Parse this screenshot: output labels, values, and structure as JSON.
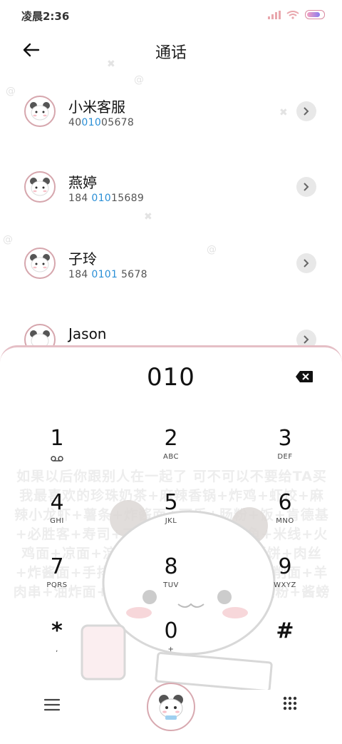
{
  "status_bar": {
    "time": "凌晨2:36"
  },
  "header": {
    "title": "通话"
  },
  "contacts": [
    {
      "name": "小米客服",
      "number_pre": "40",
      "number_hl": "010",
      "number_post": "05678"
    },
    {
      "name": "燕婷",
      "number_pre": "184 ",
      "number_hl": "010",
      "number_post": "15689"
    },
    {
      "name": "子玲",
      "number_pre": "184 ",
      "number_hl": "0101",
      "number_post": " 5678"
    },
    {
      "name": "Jason",
      "number_pre": "",
      "number_hl": "",
      "number_post": ""
    }
  ],
  "dialpad": {
    "display": "010",
    "keys": [
      {
        "digit": "1",
        "letters": ""
      },
      {
        "digit": "2",
        "letters": "ABC"
      },
      {
        "digit": "3",
        "letters": "DEF"
      },
      {
        "digit": "4",
        "letters": "GHI"
      },
      {
        "digit": "5",
        "letters": "JKL"
      },
      {
        "digit": "6",
        "letters": "MNO"
      },
      {
        "digit": "7",
        "letters": "PQRS"
      },
      {
        "digit": "8",
        "letters": "TUV"
      },
      {
        "digit": "9",
        "letters": "WXYZ"
      },
      {
        "digit": "*",
        "letters": ","
      },
      {
        "digit": "0",
        "letters": "+"
      },
      {
        "digit": "#",
        "letters": ""
      }
    ],
    "background_text": "如果以后你跟别人在一起了 可不可以不要给TA买我最喜欢的珍珠奶茶+麻辣香锅+炸鸡+虾饺+麻辣小龙虾+薯条+炸酱面+可乐+肠粉+饭+肯德基+必胜客+寿司+丁+红烧肉+铁板鱿鱼+米线+火鸡面+凉面+淀粉肠+面+烤冷面+手抓饼+肉丝+炸酱面+手排+烤鱼+大盘鸡+粉+三刀削面+羊肉串+油炸面+大份+双层芝士披萨+新疆粉+酱螃蟹"
  },
  "icons": {
    "back": "arrow-left-icon",
    "chevron": "chevron-right-icon",
    "delete": "backspace-icon",
    "voicemail": "voicemail-icon",
    "menu": "menu-icon",
    "call": "call-button-avatar",
    "keypad": "keypad-grid-icon"
  }
}
